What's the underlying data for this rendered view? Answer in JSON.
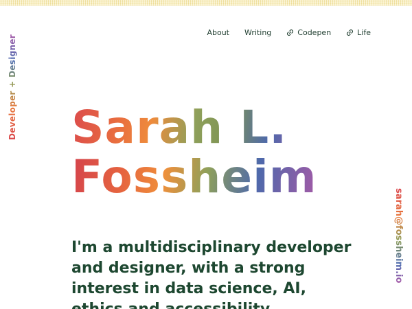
{
  "decor": {
    "stripe_color": "#e7d27a"
  },
  "nav": {
    "items": [
      {
        "label": "About",
        "icon": null
      },
      {
        "label": "Writing",
        "icon": null
      },
      {
        "label": "Codepen",
        "icon": "link-icon"
      },
      {
        "label": "Life",
        "icon": "link-icon"
      }
    ]
  },
  "tagline": "Developer + Designer",
  "email": "sarah@fossheim.io",
  "hero": {
    "name_line1": "Sarah L.",
    "name_line2": "Fossheim",
    "intro": "I'm a multidisciplinary developer and designer, with a strong interest in data science, AI, ethics and accessibility."
  },
  "colors": {
    "text_dark_green": "#1d4730",
    "gradient": [
      "#d9434a",
      "#e8783c",
      "#8a9a55",
      "#4f6db0",
      "#a65aa8"
    ]
  }
}
